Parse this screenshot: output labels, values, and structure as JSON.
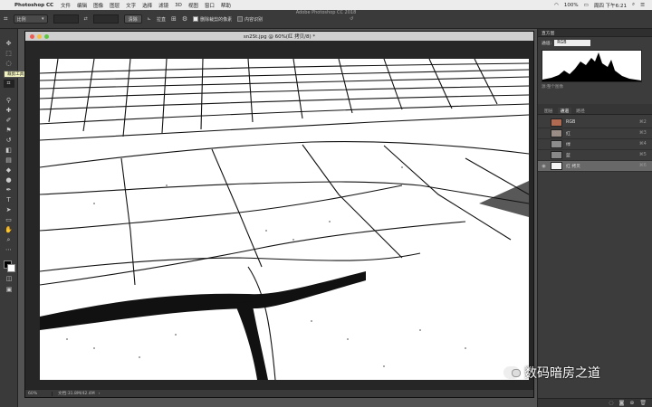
{
  "menubar": {
    "apple": "",
    "app_name": "Photoshop CC",
    "items": [
      "文件",
      "编辑",
      "图像",
      "图层",
      "文字",
      "选择",
      "滤镜",
      "3D",
      "视图",
      "窗口",
      "帮助"
    ],
    "status": {
      "battery": "100%",
      "clock": "周四 下午6:21"
    }
  },
  "window_title": "Adobe Photoshop CC 2018",
  "options_bar": {
    "ratio_select": "比例",
    "clear_button": "清除",
    "straighten_button": "拉直",
    "overlay_button": "⊞",
    "delete_cropped_label": "删除裁剪的像素",
    "content_aware_label": "内容识别"
  },
  "tooltip": "裁剪工具 (C)",
  "document": {
    "tab_title": "sn2St.jpg @ 60%(红 拷贝/8) *",
    "zoom": "60%",
    "doc_info": "文档:31.8M/42.4M"
  },
  "histogram_panel": {
    "title": "直方图",
    "channel_label": "通道:",
    "channel_value": "RGB",
    "note": "源:整个图像"
  },
  "channels_panel": {
    "tabs": [
      "图层",
      "通道",
      "路径"
    ],
    "active_tab": "通道",
    "rows": [
      {
        "name": "RGB",
        "shortcut": "⌘2",
        "color": "#b06a52"
      },
      {
        "name": "红",
        "shortcut": "⌘3",
        "color": "#9a8d86"
      },
      {
        "name": "绿",
        "shortcut": "⌘4",
        "color": "#8c8c8c"
      },
      {
        "name": "蓝",
        "shortcut": "⌘5",
        "color": "#888888"
      },
      {
        "name": "红 拷贝",
        "shortcut": "⌘6",
        "color": "#f2f2f2"
      }
    ]
  },
  "watermark": "数码暗房之道"
}
